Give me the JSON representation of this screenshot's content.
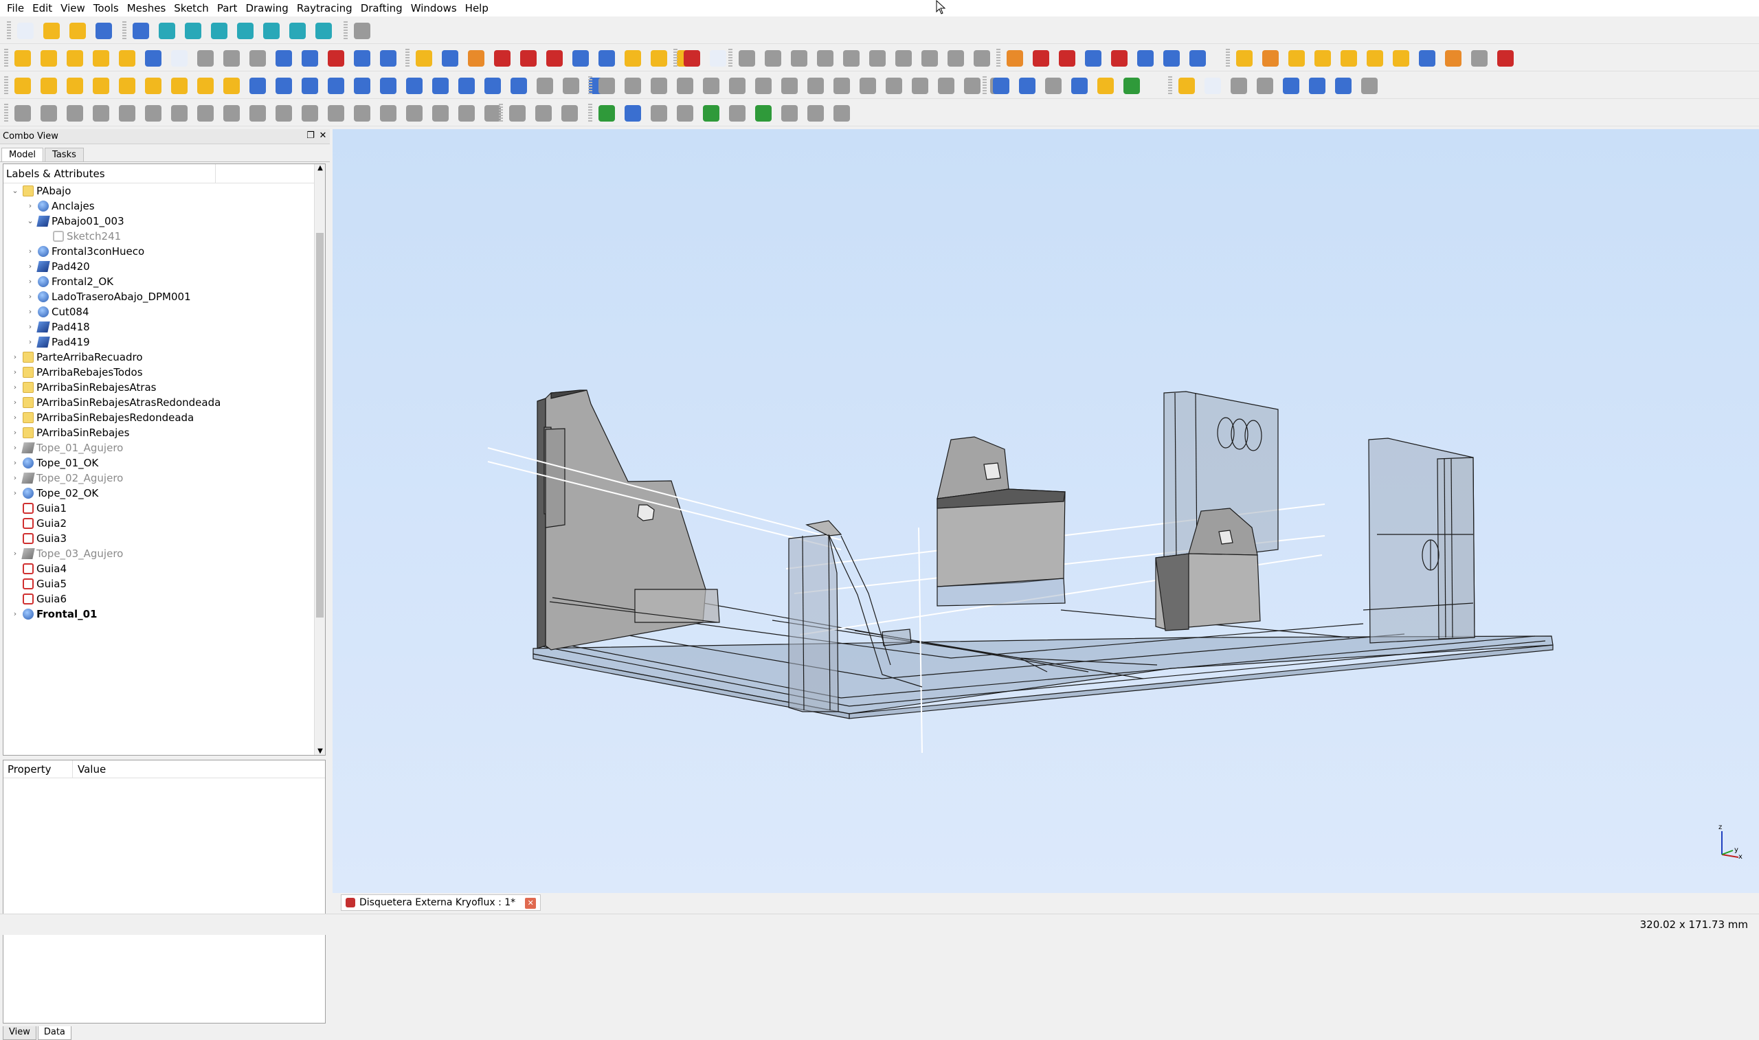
{
  "menubar": [
    "File",
    "Edit",
    "View",
    "Tools",
    "Meshes",
    "Sketch",
    "Part",
    "Drawing",
    "Raytracing",
    "Drafting",
    "Windows",
    "Help"
  ],
  "combo": {
    "title": "Combo View",
    "tabs": [
      "Model",
      "Tasks"
    ],
    "tree_header": "Labels & Attributes",
    "tree": [
      {
        "label": "PAbajo",
        "level": 0,
        "expanded": true,
        "icon": "folder-icon"
      },
      {
        "label": "Anclajes",
        "level": 1,
        "expanded": false,
        "icon": "body-icon"
      },
      {
        "label": "PAbajo01_003",
        "level": 1,
        "expanded": true,
        "icon": "pad-icon"
      },
      {
        "label": "Sketch241",
        "level": 2,
        "icon": "sketch-icon",
        "dim": true
      },
      {
        "label": "Frontal3conHueco",
        "level": 1,
        "expanded": false,
        "icon": "body-icon"
      },
      {
        "label": "Pad420",
        "level": 1,
        "expanded": false,
        "icon": "pad-icon"
      },
      {
        "label": "Frontal2_OK",
        "level": 1,
        "expanded": false,
        "icon": "body-icon"
      },
      {
        "label": "LadoTraseroAbajo_DPM001",
        "level": 1,
        "expanded": false,
        "icon": "body-icon"
      },
      {
        "label": "Cut084",
        "level": 1,
        "expanded": false,
        "icon": "body-icon"
      },
      {
        "label": "Pad418",
        "level": 1,
        "expanded": false,
        "icon": "pad-icon"
      },
      {
        "label": "Pad419",
        "level": 1,
        "expanded": false,
        "icon": "pad-icon"
      },
      {
        "label": "ParteArribaRecuadro",
        "level": 0,
        "expanded": false,
        "icon": "folder-icon"
      },
      {
        "label": "PArribaRebajesTodos",
        "level": 0,
        "expanded": false,
        "icon": "folder-icon"
      },
      {
        "label": "PArribaSinRebajesAtras",
        "level": 0,
        "expanded": false,
        "icon": "folder-icon"
      },
      {
        "label": "PArribaSinRebajesAtrasRedondeada",
        "level": 0,
        "expanded": false,
        "icon": "folder-icon"
      },
      {
        "label": "PArribaSinRebajesRedondeada",
        "level": 0,
        "expanded": false,
        "icon": "folder-icon"
      },
      {
        "label": "PArribaSinRebajes",
        "level": 0,
        "expanded": false,
        "icon": "folder-icon"
      },
      {
        "label": "Tope_01_Agujero",
        "level": 0,
        "expanded": false,
        "icon": "gray-icon",
        "dim": true
      },
      {
        "label": "Tope_01_OK",
        "level": 0,
        "expanded": false,
        "icon": "body-icon"
      },
      {
        "label": "Tope_02_Agujero",
        "level": 0,
        "expanded": false,
        "icon": "gray-icon",
        "dim": true
      },
      {
        "label": "Tope_02_OK",
        "level": 0,
        "expanded": false,
        "icon": "body-icon"
      },
      {
        "label": "Guia1",
        "level": 0,
        "icon": "sketch-icon"
      },
      {
        "label": "Guia2",
        "level": 0,
        "icon": "sketch-icon"
      },
      {
        "label": "Guia3",
        "level": 0,
        "icon": "sketch-icon"
      },
      {
        "label": "Tope_03_Agujero",
        "level": 0,
        "expanded": false,
        "icon": "gray-icon",
        "dim": true
      },
      {
        "label": "Guia4",
        "level": 0,
        "icon": "sketch-icon"
      },
      {
        "label": "Guia5",
        "level": 0,
        "icon": "sketch-icon"
      },
      {
        "label": "Guia6",
        "level": 0,
        "icon": "sketch-icon"
      },
      {
        "label": "Frontal_01",
        "level": 0,
        "expanded": false,
        "icon": "body-icon",
        "bold": true
      }
    ],
    "props_headers": [
      "Property",
      "Value"
    ],
    "bottom_tabs": [
      "View",
      "Data"
    ]
  },
  "document_tab": "Disquetera Externa Kryoflux : 1*",
  "status_dimensions": "320.02 x 171.73 mm",
  "axis_labels": {
    "z": "z",
    "x": "x",
    "y": "y"
  },
  "colors": {
    "viewport_top": "#cadff8",
    "viewport_bottom": "#dce9fb",
    "solid_gray": "#a9a9a9",
    "solid_dark": "#7a7a7a"
  }
}
